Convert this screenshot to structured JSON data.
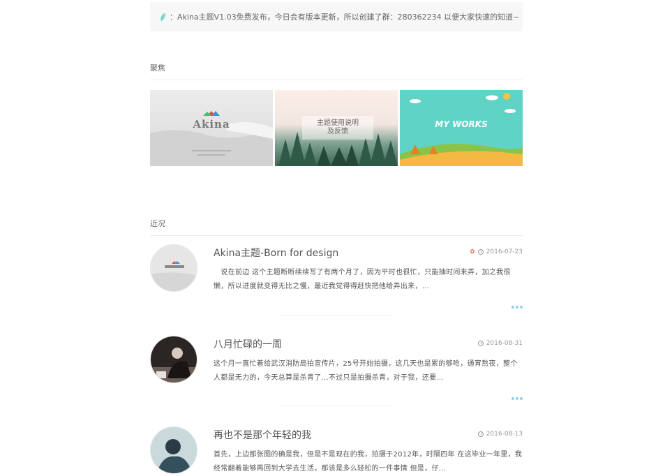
{
  "notice": {
    "icon": "leaf-icon",
    "text": "：Akina主题V1.03免费发布，今日会有版本更新，所以创建了群：280362234 以便大家快速的知道~"
  },
  "focus": {
    "title": "聚焦",
    "items": [
      {
        "label": "Akina"
      },
      {
        "label": "主题使用说明\n及反馈"
      },
      {
        "label": "MY WORKS"
      }
    ]
  },
  "recent": {
    "title": "近况",
    "posts": [
      {
        "title": "Akina主题-Born for design",
        "date": "2016-07-23",
        "hot": true,
        "excerpt": "　说在前边 这个主题断断续续写了有两个月了，因为平时也很忙，只能抽时间来弄，加之我很懒，所以进度就变得无比之慢，最近我觉得得赶快把他给弄出来，..."
      },
      {
        "title": "八月忙碌的一周",
        "date": "2016-08-31",
        "hot": false,
        "excerpt": "这个月一直忙着给武汉消防局拍宣传片，25号开始拍摄，这几天也是累的够呛，通宵熬夜，整个人都是无力的，今天总算是杀青了...不过只是拍摄杀青，对于我，还要..."
      },
      {
        "title": "再也不是那个年轻的我",
        "date": "2016-08-13",
        "hot": false,
        "excerpt": "首先，上边那张图的确是我，但是不是现在的我，拍摄于2012年，时隔四年 在这毕业一年里，我经常翻着能够再回到大学去生活，那该是多么轻松的一件事情 但是，仔..."
      }
    ]
  },
  "colors": {
    "accent": "#8fd4e8",
    "hot": "#e76f51",
    "works_bg": "#5fd3c5"
  }
}
